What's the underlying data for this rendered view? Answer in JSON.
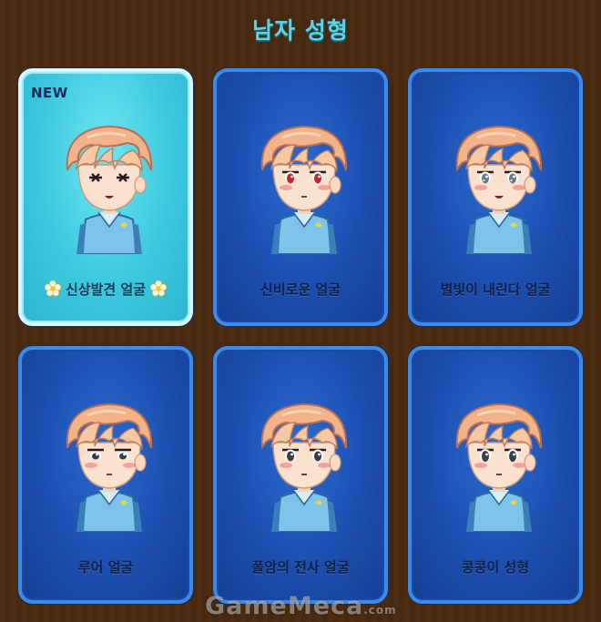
{
  "header": {
    "title": "남자 성형"
  },
  "cards": [
    {
      "label": "신상발견 얼굴",
      "badge": "NEW",
      "highlight": true,
      "eyes": "closed",
      "mouth": "open",
      "flowers": true
    },
    {
      "label": "신비로운 얼굴",
      "badge": "",
      "highlight": false,
      "eyes": "red",
      "mouth": "small",
      "flowers": false
    },
    {
      "label": "별빛이 내린다 얼굴",
      "badge": "",
      "highlight": false,
      "eyes": "sparkle",
      "mouth": "open",
      "flowers": false
    },
    {
      "label": "루어 얼굴",
      "badge": "",
      "highlight": false,
      "eyes": "sleepy",
      "mouth": "small",
      "flowers": false
    },
    {
      "label": "폴암의 전사 얼굴",
      "badge": "",
      "highlight": false,
      "eyes": "sharp",
      "mouth": "small",
      "flowers": false
    },
    {
      "label": "콩콩이 성형",
      "badge": "",
      "highlight": false,
      "eyes": "round",
      "mouth": "small",
      "flowers": false
    }
  ],
  "watermark": {
    "text": "GameMeca",
    "suffix": ".com"
  },
  "colors": {
    "background": "#4a2a10",
    "card_blue": "#1c4fb0",
    "card_new": "#3cc9df",
    "hair": "#f2b38a",
    "title": "#5fd3e6"
  }
}
